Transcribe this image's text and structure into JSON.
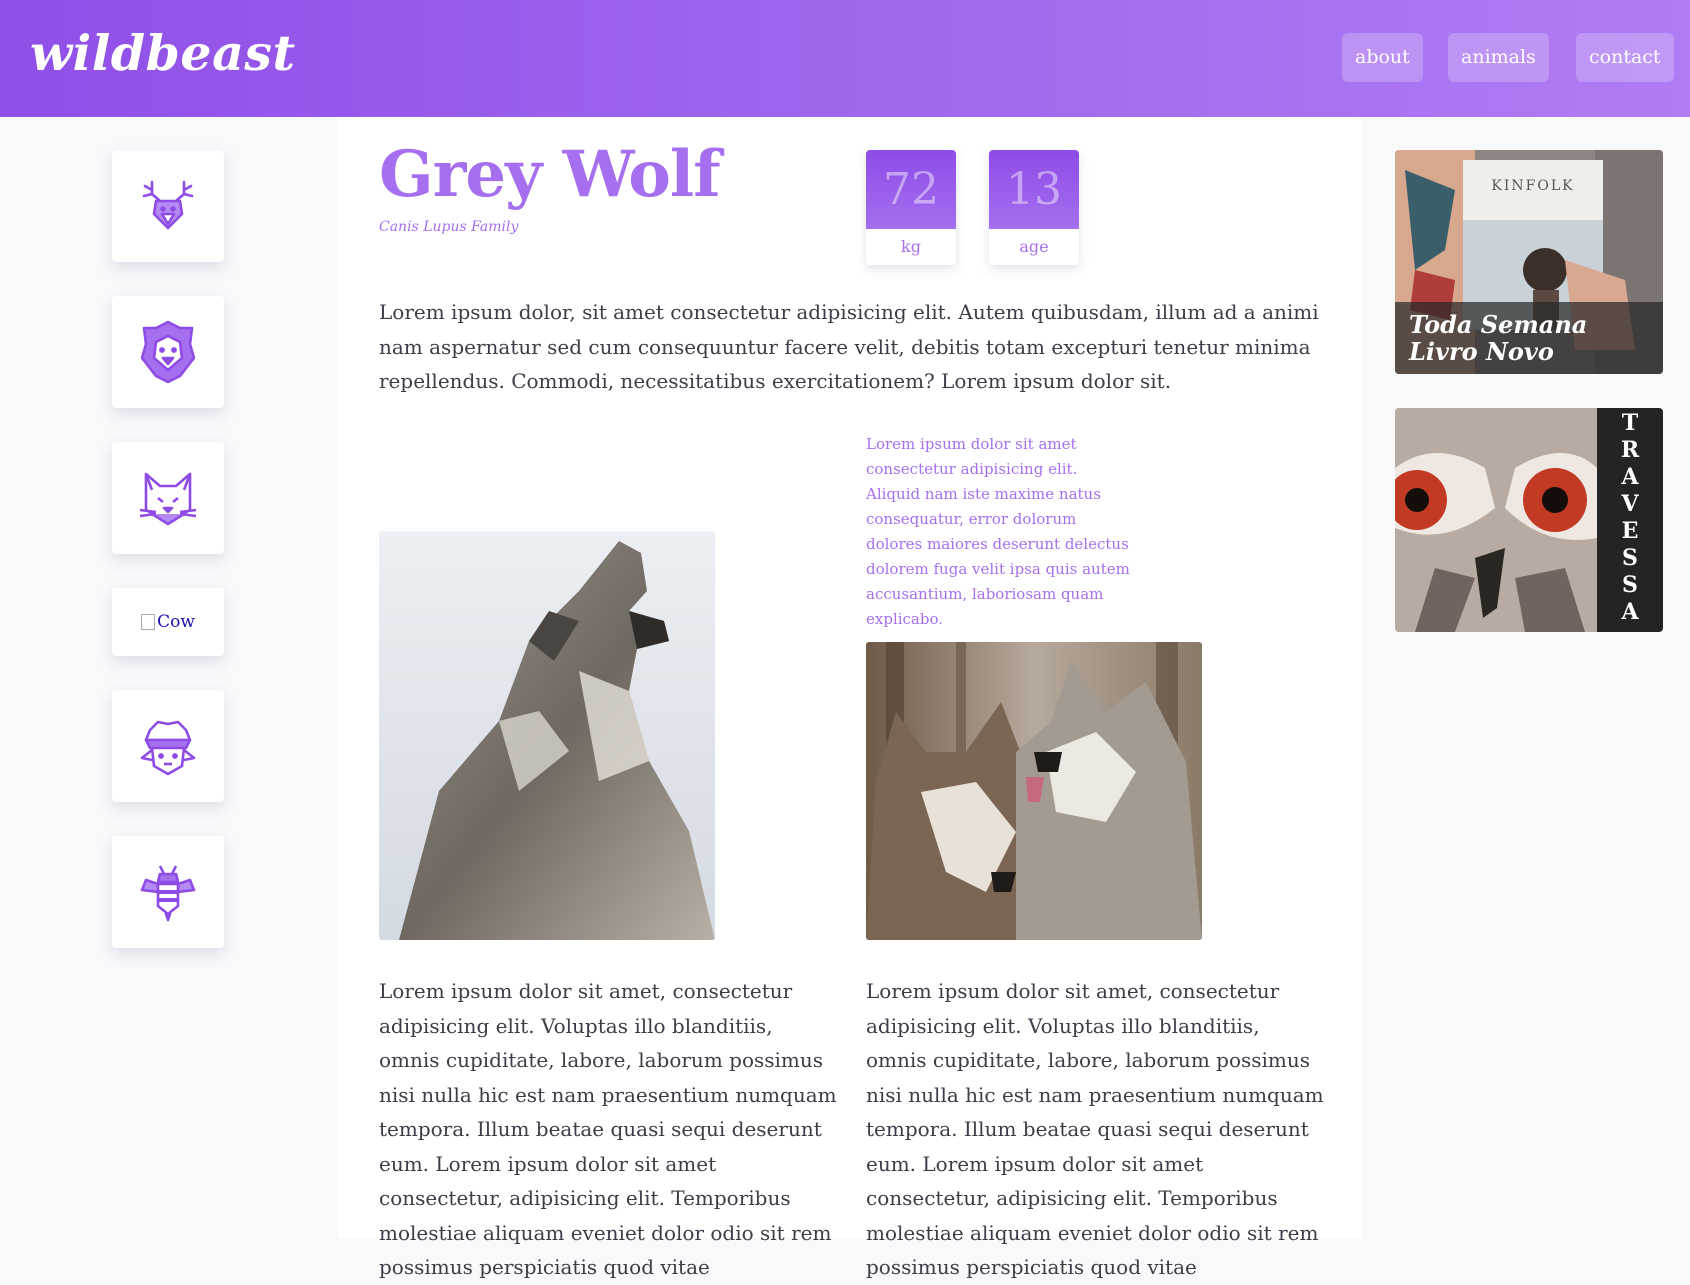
{
  "header": {
    "logo": "wildbeast",
    "nav": [
      "about",
      "animals",
      "contact"
    ]
  },
  "sidebar": {
    "items": [
      {
        "icon": "deer-icon"
      },
      {
        "icon": "lion-icon"
      },
      {
        "icon": "cat-icon"
      },
      {
        "icon": "cow-broken-image",
        "alt": "Cow"
      },
      {
        "icon": "sheep-icon"
      },
      {
        "icon": "bee-icon"
      }
    ]
  },
  "animal": {
    "name": "Grey Wolf",
    "family": "Canis Lupus Family",
    "weight_value": "72",
    "weight_unit": "kg",
    "age_value": "13",
    "age_unit": "age"
  },
  "content": {
    "intro": "Lorem ipsum dolor, sit amet consectetur adipisicing elit. Autem quibusdam, illum ad a animi nam aspernatur sed cum consequuntur facere velit, debitis totam excepturi tenetur minima repellendus. Commodi, necessitatibus exercitationem? Lorem ipsum dolor sit.",
    "aside": "Lorem ipsum dolor sit amet consectetur adipisicing elit. Aliquid nam iste maxime natus consequatur, error dolorum dolores maiores deserunt delectus dolorem fuga velit ipsa quis autem accusantium, laboriosam quam explicabo.",
    "col_left": "Lorem ipsum dolor sit amet, consectetur adipisicing elit. Voluptas illo blanditiis, omnis cupiditate, labore, laborum possimus nisi nulla hic est nam praesentium numquam tempora. Illum beatae quasi sequi deserunt eum. Lorem ipsum dolor sit amet consectetur, adipisicing elit. Temporibus molestiae aliquam eveniet dolor odio sit rem possimus perspiciatis quod vitae",
    "col_right": "Lorem ipsum dolor sit amet, consectetur adipisicing elit. Voluptas illo blanditiis, omnis cupiditate, labore, laborum possimus nisi nulla hic est nam praesentium numquam tempora. Illum beatae quasi sequi deserunt eum. Lorem ipsum dolor sit amet consectetur, adipisicing elit. Temporibus molestiae aliquam eveniet dolor odio sit rem possimus perspiciatis quod vitae"
  },
  "ads": {
    "kinfolk_brand": "KINFOLK",
    "kinfolk_line1": "Toda Semana",
    "kinfolk_line2": "Livro Novo",
    "travessa_letters": [
      "T",
      "R",
      "A",
      "V",
      "E",
      "S",
      "S",
      "A"
    ]
  },
  "colors": {
    "accent": "#a66ff0",
    "header_start": "#904fe7",
    "header_end": "#b07cf3"
  }
}
